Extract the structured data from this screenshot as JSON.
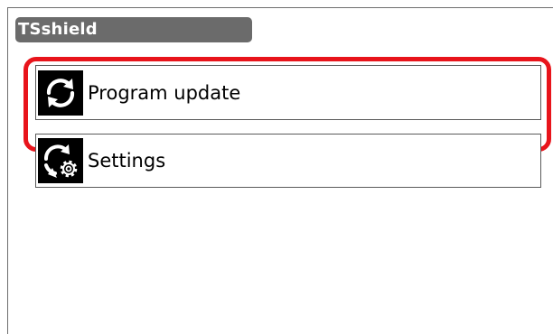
{
  "app": {
    "title": "TSshield"
  },
  "menu": {
    "items": [
      {
        "label": "Program update",
        "icon": "refresh-icon",
        "highlighted": true
      },
      {
        "label": "Settings",
        "icon": "settings-sync-icon",
        "highlighted": false
      }
    ]
  },
  "colors": {
    "title_bar": "#6b6b6b",
    "highlight": "#e8141b",
    "icon_background": "#000000"
  }
}
